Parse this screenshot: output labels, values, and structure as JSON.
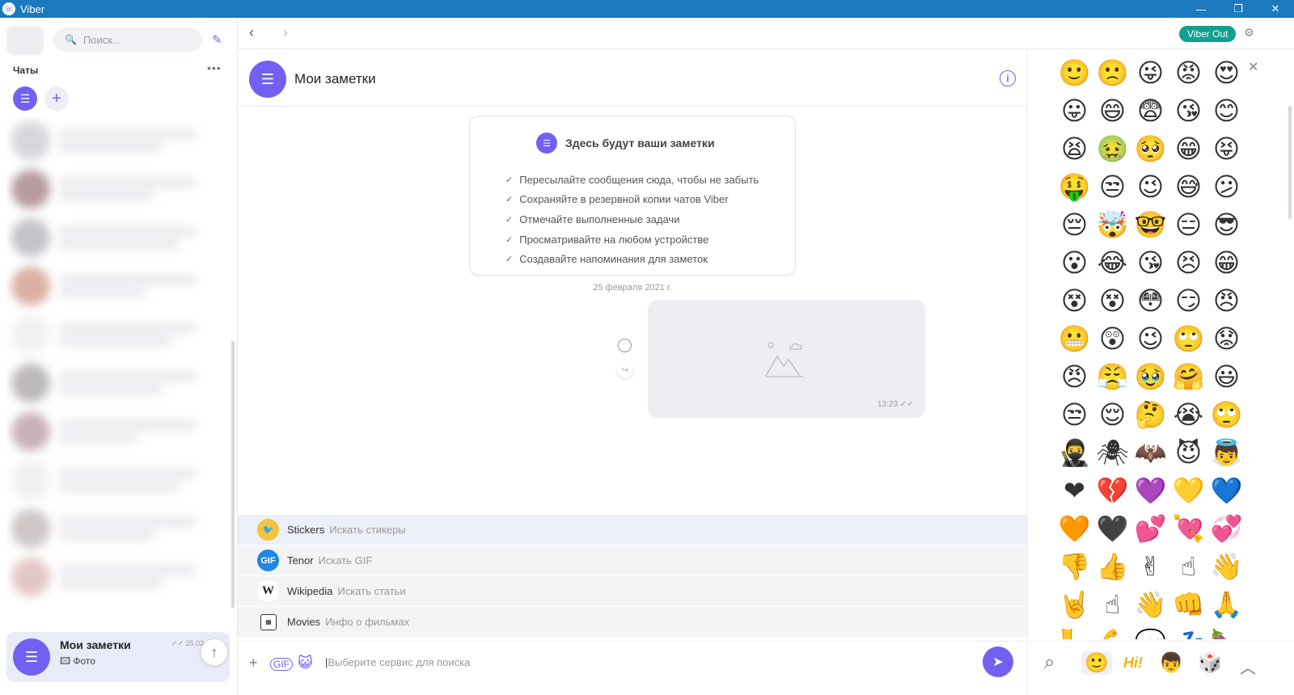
{
  "window": {
    "title": "Viber",
    "controls": [
      "—",
      "❐",
      "✕"
    ]
  },
  "sidebar": {
    "search_placeholder": "Поиск...",
    "chats_label": "Чаты",
    "active_chat": {
      "name": "Мои заметки",
      "subtitle": "Фото",
      "date": "25.02"
    }
  },
  "topnav": {
    "viber_out": "Viber Out"
  },
  "chat": {
    "title": "Мои заметки",
    "welcome": {
      "title": "Здесь будут ваши заметки",
      "items": [
        "Пересылайте сообщения сюда, чтобы не забыть",
        "Сохраняйте в резервной копии чатов Viber",
        "Отмечайте выполненные задачи",
        "Просматривайте на любом устройстве",
        "Создавайте напоминания для заметок"
      ]
    },
    "date_separator": "25 февраля 2021 г.",
    "photo_message": {
      "time": "13:23"
    },
    "services": [
      {
        "name": "Stickers",
        "desc": "Искать стикеры"
      },
      {
        "name": "Tenor",
        "desc": "Искать GIF"
      },
      {
        "name": "Wikipedia",
        "desc": "Искать статьи"
      },
      {
        "name": "Movies",
        "desc": "Инфо о фильмах"
      }
    ],
    "input_placeholder": "Выберите сервис для поиска"
  },
  "emoji_panel": {
    "emojis": [
      "🙂",
      "🙁",
      "😜",
      "😡",
      "😍",
      "😛",
      "😄",
      "😨",
      "😘",
      "😊",
      "😫",
      "🤢",
      "🥺",
      "😁",
      "😝",
      "🤑",
      "😒",
      "😉",
      "😅",
      "😕",
      "😔",
      "🤯",
      "🤓",
      "😑",
      "😎",
      "😮",
      "😂",
      "😘",
      "😣",
      "😁",
      "😵",
      "😵",
      "😳",
      "😏",
      "😠",
      "😬",
      "😲",
      "😉",
      "🙄",
      "😟",
      "😠",
      "😤",
      "🥹",
      "🤗",
      "😃",
      "😒",
      "😌",
      "🤔",
      "😭",
      "🙄",
      "🥷",
      "🕷",
      "🦇",
      "😈",
      "👼",
      "❤",
      "💔",
      "💜",
      "💛",
      "💙",
      "🧡",
      "🖤",
      "💕",
      "💘",
      "💞",
      "👎",
      "👍",
      "✌",
      "☝",
      "👋",
      "🤘",
      "☝",
      "👋",
      "👊",
      "🙏",
      "🦶",
      "💪",
      "💬",
      "💤",
      "🍆"
    ],
    "tabs": [
      "search-icon",
      "smiley-icon",
      "hi-sticker-icon",
      "character-sticker-icon",
      "dice-sticker-icon",
      "chevron-up-icon"
    ]
  }
}
